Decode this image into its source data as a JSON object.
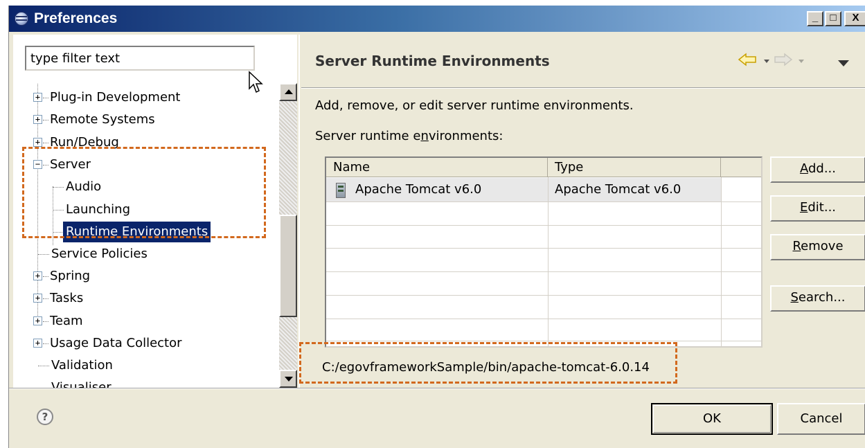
{
  "window": {
    "title": "Preferences",
    "controls": {
      "minimize": "_",
      "maximize": "□",
      "close": "X"
    }
  },
  "filter": {
    "value": "type filter text"
  },
  "tree": {
    "items": [
      {
        "label": "Plug-in Development",
        "expander": "+"
      },
      {
        "label": "Remote Systems",
        "expander": "+"
      },
      {
        "label": "Run/Debug",
        "expander": "+"
      },
      {
        "label": "Server",
        "expander": "−"
      },
      {
        "label": "Audio"
      },
      {
        "label": "Launching"
      },
      {
        "label": "Runtime Environments",
        "selected": true
      },
      {
        "label": "Service Policies"
      },
      {
        "label": "Spring",
        "expander": "+"
      },
      {
        "label": "Tasks",
        "expander": "+"
      },
      {
        "label": "Team",
        "expander": "+"
      },
      {
        "label": "Usage Data Collector",
        "expander": "+"
      },
      {
        "label": "Validation"
      },
      {
        "label": "Visualiser"
      }
    ]
  },
  "page": {
    "title": "Server Runtime Environments",
    "description": "Add, remove, or edit server runtime environments.",
    "list_label_pre": "Server runtime e",
    "list_label_mnemonic": "n",
    "list_label_post": "vironments:",
    "table": {
      "columns": [
        "Name",
        "Type"
      ],
      "rows": [
        {
          "name": "Apache Tomcat v6.0",
          "type": "Apache Tomcat v6.0"
        }
      ]
    },
    "buttons": {
      "add": {
        "mnemonic": "A",
        "rest": "dd..."
      },
      "edit": {
        "mnemonic": "E",
        "rest": "dit..."
      },
      "remove": {
        "mnemonic": "R",
        "rest": "emove"
      },
      "search": {
        "mnemonic": "S",
        "rest": "earch..."
      }
    },
    "location": "C:/egovframeworkSample/bin/apache-tomcat-6.0.14"
  },
  "footer": {
    "help": "?",
    "ok": "OK",
    "cancel": "Cancel"
  },
  "colors": {
    "highlight_dash": "#d2691e",
    "selection": "#0a246a",
    "titlebar_start": "#0a246a",
    "titlebar_end": "#a6caf0"
  }
}
